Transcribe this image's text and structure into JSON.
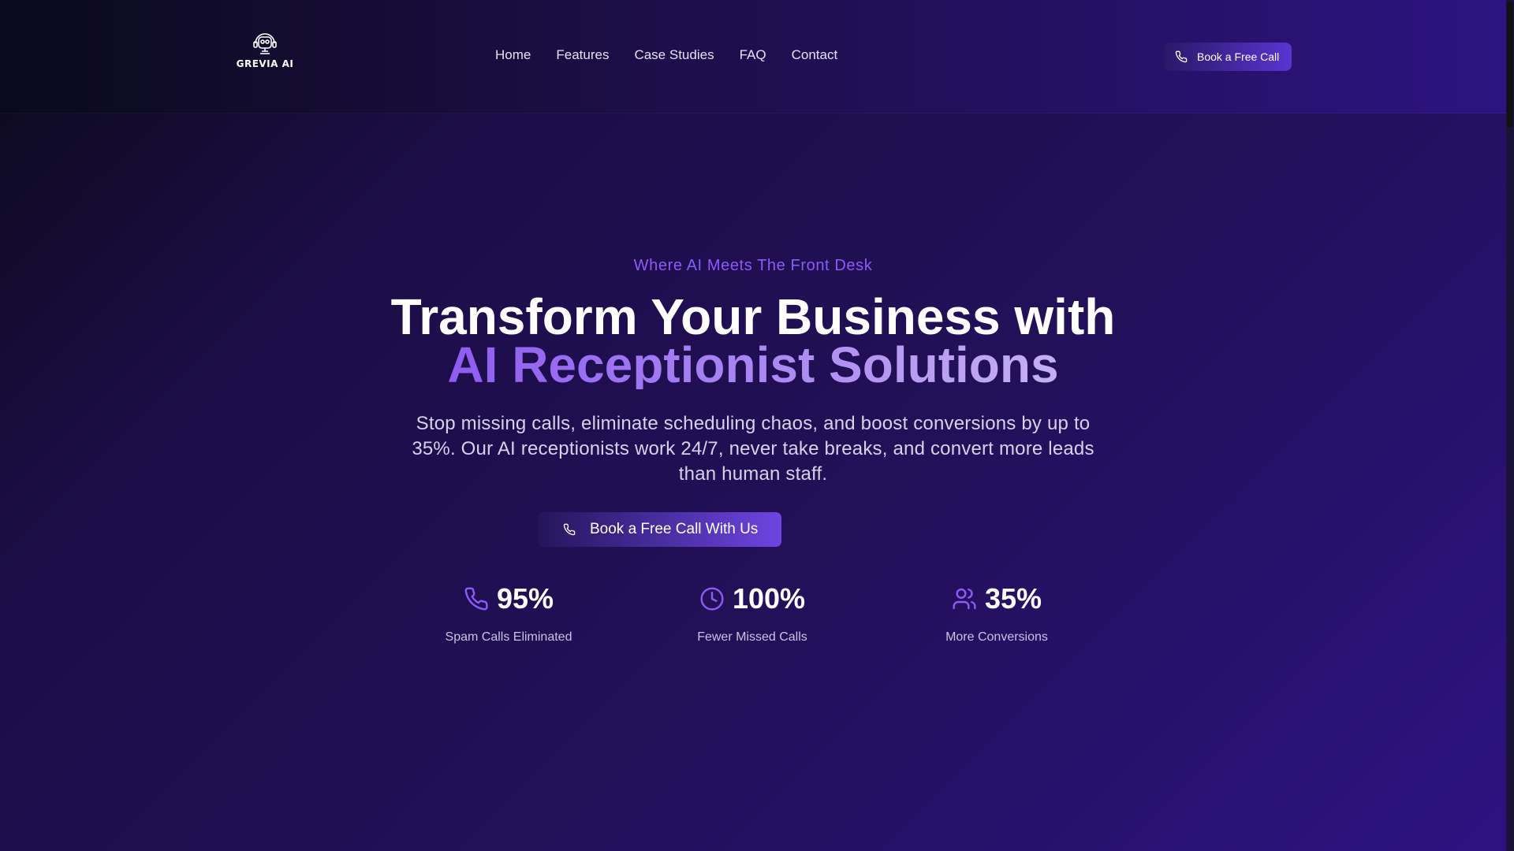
{
  "header": {
    "logo_text": "GREVIA AI",
    "nav": [
      {
        "label": "Home"
      },
      {
        "label": "Features"
      },
      {
        "label": "Case Studies"
      },
      {
        "label": "FAQ"
      },
      {
        "label": "Contact"
      }
    ],
    "cta_label": "Book a Free Call"
  },
  "hero": {
    "eyebrow": "Where AI Meets The Front Desk",
    "headline_line1": "Transform Your Business with",
    "headline_line2": "AI Receptionist Solutions",
    "subtitle": "Stop missing calls, eliminate scheduling chaos, and boost conversions by up to 35%. Our AI receptionists work 24/7, never take breaks, and convert more leads than human staff.",
    "cta_label": "Book a Free Call With Us"
  },
  "stats": [
    {
      "icon": "phone-icon",
      "value": "95%",
      "label": "Spam Calls Eliminated"
    },
    {
      "icon": "clock-icon",
      "value": "100%",
      "label": "Fewer Missed Calls"
    },
    {
      "icon": "users-icon",
      "value": "35%",
      "label": "More Conversions"
    }
  ],
  "colors": {
    "accent": "#8b5cf6",
    "accent_light": "#c5b0f3",
    "background_dark": "#0b0a1a",
    "background_purple": "#2e1282"
  }
}
